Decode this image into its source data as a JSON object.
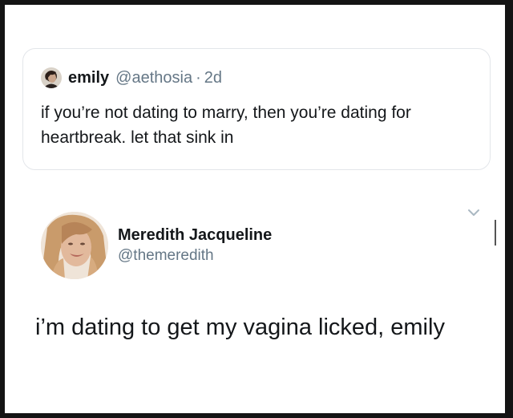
{
  "quoted_tweet": {
    "name": "emily",
    "handle": "@aethosia",
    "separator": "·",
    "time": "2d",
    "text": "if you’re not dating to marry, then you’re dating for heartbreak. let that sink in"
  },
  "tweet": {
    "name": "Meredith Jacqueline",
    "handle": "@themeredith",
    "text": "i’m dating to get my vagina licked, emily"
  },
  "icons": {
    "menu": "chevron-down-icon"
  },
  "colors": {
    "text_primary": "#14171a",
    "text_secondary": "#657786",
    "border": "#e3e6ea",
    "frame": "#141414"
  }
}
